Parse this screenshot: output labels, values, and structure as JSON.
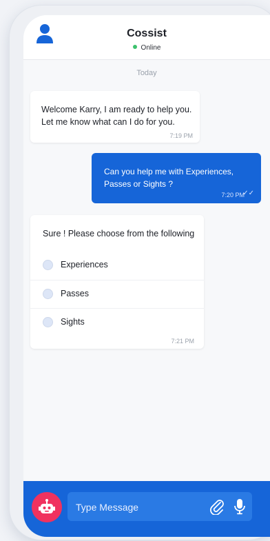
{
  "header": {
    "title": "Cossist",
    "status": "Online"
  },
  "chat": {
    "day_label": "Today",
    "messages": [
      {
        "from": "bot",
        "text": "Welcome Karry, I am ready to help you. Let me know what can I do for you.",
        "time": "7:19 PM"
      },
      {
        "from": "user",
        "text": "Can you help me with Experiences, Passes or Sights ?",
        "time": "7:20 PM"
      },
      {
        "from": "bot",
        "text": "Sure ! Please choose from the following",
        "options": [
          "Experiences",
          "Passes",
          "Sights"
        ],
        "time": "7:21 PM"
      }
    ]
  },
  "composer": {
    "placeholder": "Type Message"
  },
  "colors": {
    "accent": "#1665d8",
    "bot_avatar": "#f0325f",
    "online": "#3cc16d"
  },
  "icons": [
    "user-icon",
    "bot-icon",
    "paperclip-icon",
    "microphone-icon",
    "double-check-icon"
  ]
}
